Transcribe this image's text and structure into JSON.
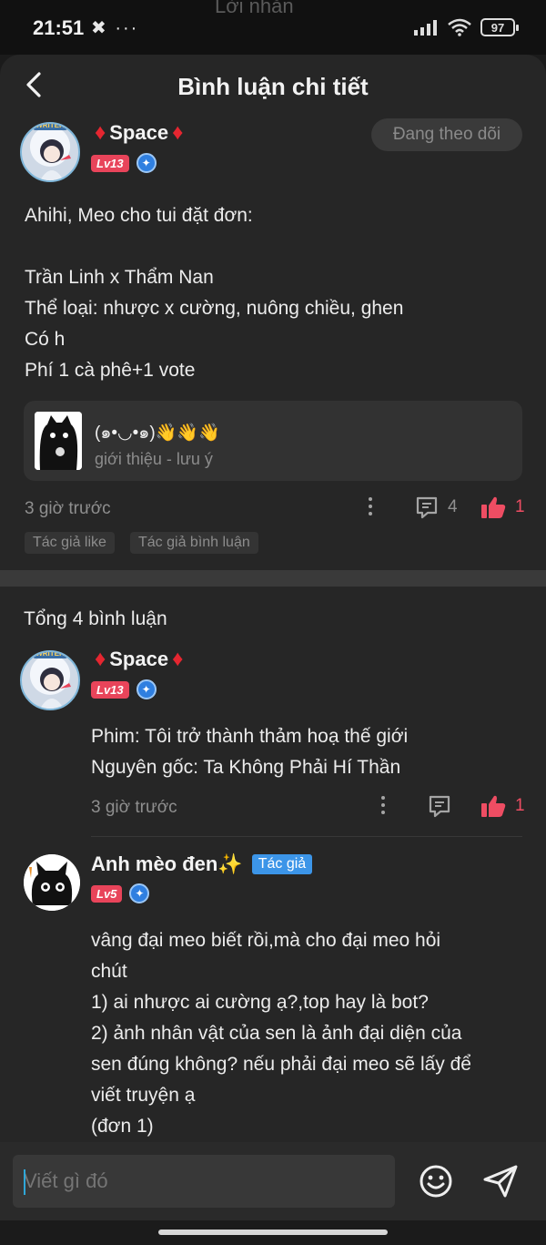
{
  "status_bar": {
    "time": "21:51",
    "left_icons": "✖ ···",
    "ghost_title": "Lời nhắn",
    "battery": "97"
  },
  "header": {
    "title": "Bình luận chi tiết"
  },
  "main_post": {
    "author_name": "Space",
    "level": "Lv13",
    "follow_label": "Đang theo dõi",
    "text": "Ahihi, Meo cho tui đặt đơn:\n\nTrần Linh x Thẩm Nan\nThể loại: nhược x cường, nuông chiều, ghen\nCó h\nPhí 1 cà phê+1 vote",
    "linked": {
      "title": "(๑•◡•๑)👋👋👋",
      "subtitle": "giới thiệu - lưu ý"
    },
    "time": "3 giờ trước",
    "comment_count": "4",
    "like_count": "1",
    "tags": [
      "Tác giả like",
      "Tác giả bình luận"
    ]
  },
  "comments_section": {
    "title": "Tổng 4 bình luận",
    "comments": [
      {
        "author_name": "Space",
        "level": "Lv13",
        "text": "Phim: Tôi trở thành thảm hoạ thế giới\nNguyên gốc: Ta Không Phải Hí Thần",
        "time": "3 giờ trước",
        "like_count": "1"
      },
      {
        "author_name": "Anh mèo đen✨",
        "author_tag": "Tác giả",
        "level": "Lv5",
        "text": "vâng đại meo biết rồi,mà cho đại meo hỏi\nchút\n1) ai nhược ai cường ạ?,top hay là bot?\n2) ảnh nhân vật của sen là ảnh đại diện của\nsen đúng không? nếu phải đại meo sẽ lấy để\nviết truyện ạ\n(đơn 1)"
      }
    ]
  },
  "composer": {
    "placeholder": "Viết gì đó"
  },
  "colors": {
    "background": "#262626",
    "accent_like": "#ee4d63",
    "level_badge": "#e8445a",
    "author_tag": "#3c95e8",
    "diamond": "#e52630"
  },
  "icons": [
    "back-arrow-icon",
    "diamond-icon",
    "verified-icon",
    "more-icon",
    "comment-icon",
    "thumbs-up-icon",
    "emoji-icon",
    "send-icon"
  ]
}
